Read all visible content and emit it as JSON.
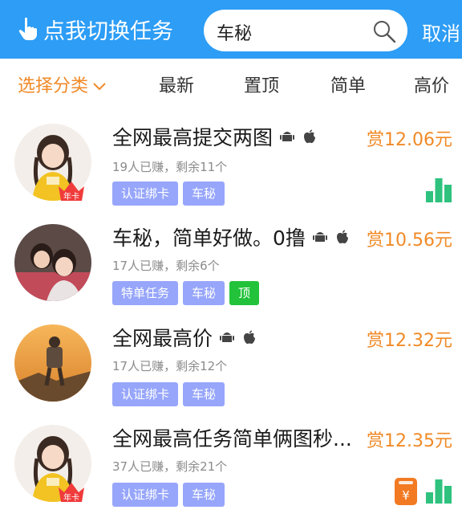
{
  "header": {
    "switch_task_label": "点我切换任务",
    "search_value": "车秘",
    "cancel_label": "取消"
  },
  "filters": {
    "category_label": "选择分类",
    "items": [
      "最新",
      "置顶",
      "简单",
      "高价"
    ]
  },
  "tasks": [
    {
      "title": "全网最高提交两图",
      "price": "赏12.06元",
      "meta": "19人已赚，剩余11个",
      "tags": [
        "认证绑卡",
        "车秘"
      ],
      "avatar_badge": "年卡"
    },
    {
      "title": "车秘，简单好做。0撸",
      "price": "赏10.56元",
      "meta": "17人已赚，剩余6个",
      "tags": [
        "特单任务",
        "车秘",
        "顶"
      ]
    },
    {
      "title": "全网最高价",
      "price": "赏12.32元",
      "meta": "17人已赚，剩余12个",
      "tags": [
        "认证绑卡",
        "车秘"
      ]
    },
    {
      "title": "全网最高任务简单俩图秒...",
      "price": "赏12.35元",
      "meta": "37人已赚，剩余21个",
      "tags": [
        "认证绑卡",
        "车秘"
      ],
      "avatar_badge": "年卡"
    }
  ],
  "colors": {
    "header_bg": "#2d9df5",
    "accent_orange": "#f08a27",
    "tag_blue": "#97a6fb",
    "tag_green": "#22c33a",
    "bars_green": "#2ec27e"
  },
  "icons": [
    "hand-pointer-icon",
    "search-icon",
    "chevron-down-icon",
    "android-icon",
    "apple-icon",
    "bar-chart-icon",
    "yuan-coupon-icon"
  ]
}
